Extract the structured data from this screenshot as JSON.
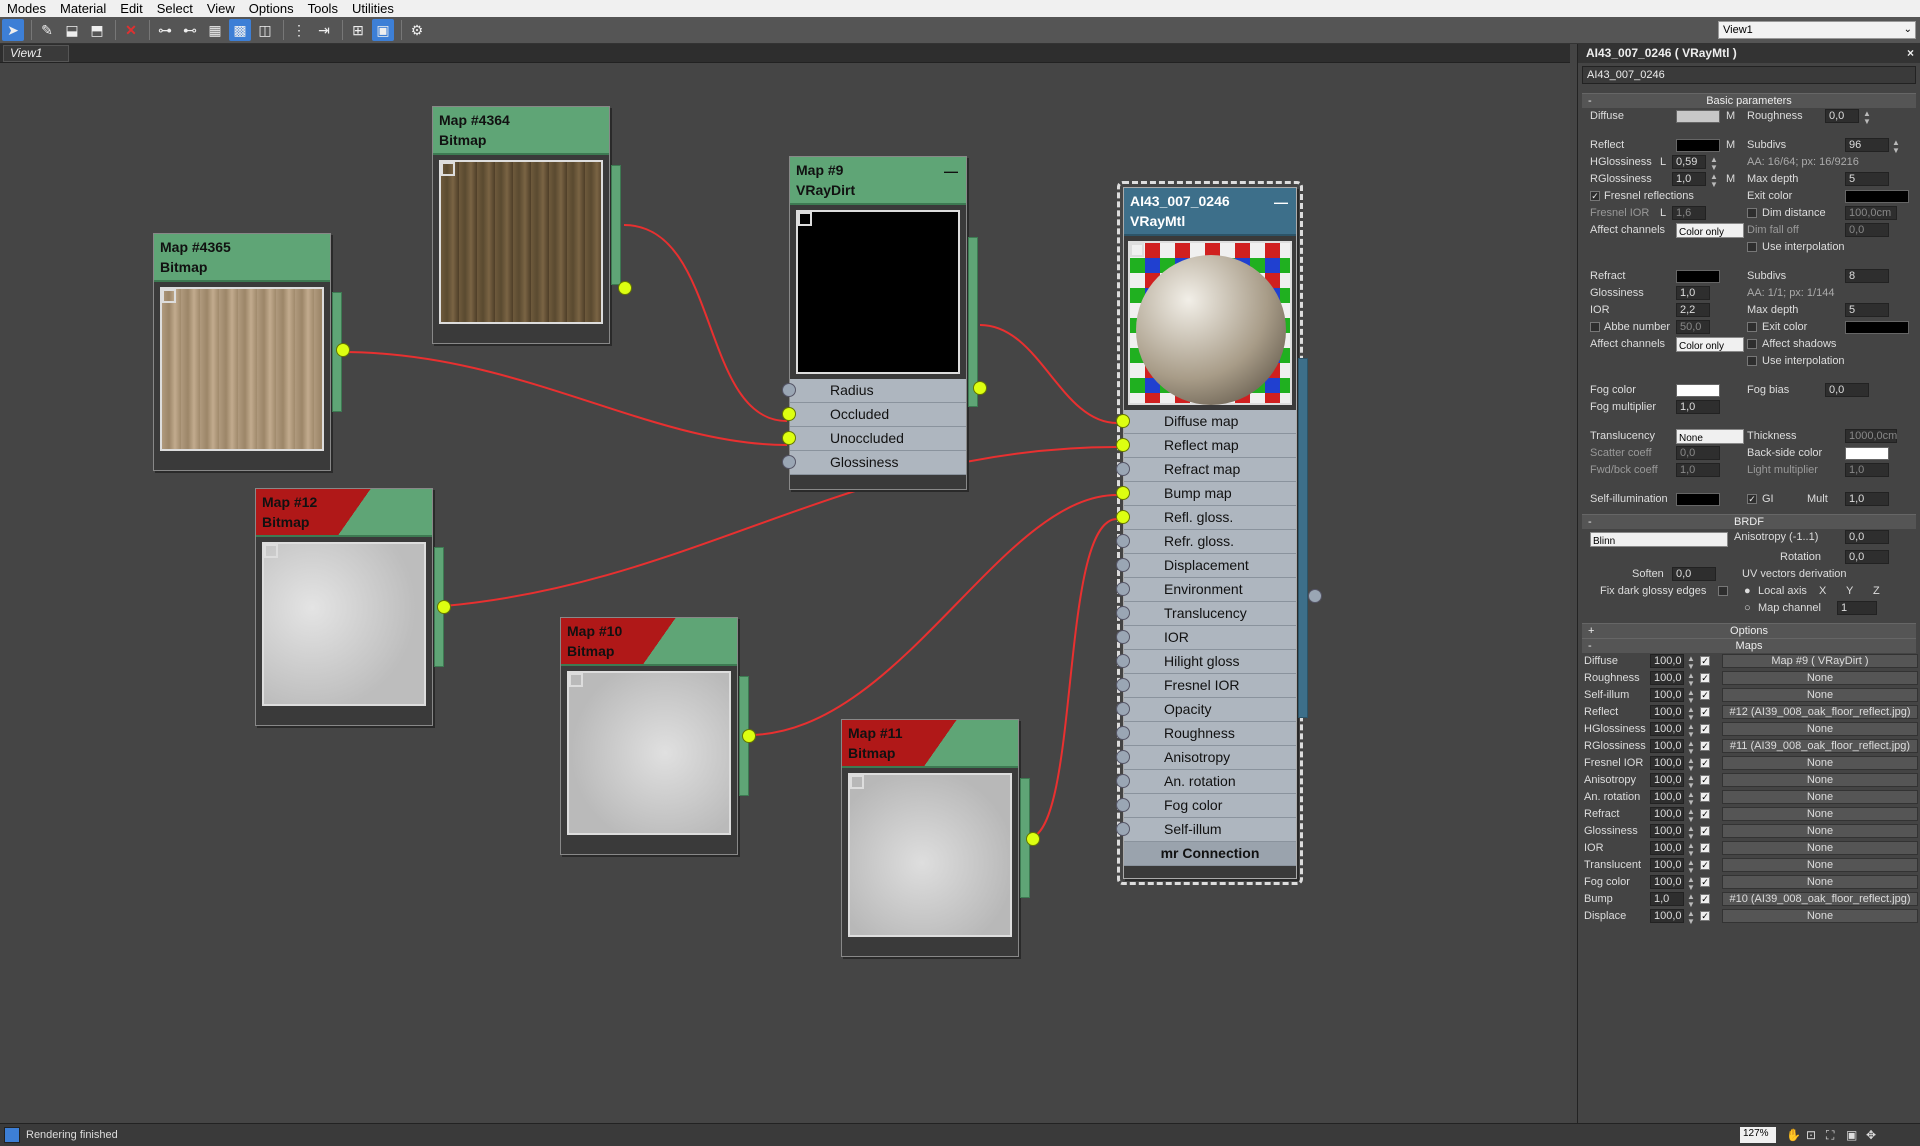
{
  "menu": [
    "Modes",
    "Material",
    "Edit",
    "Select",
    "View",
    "Options",
    "Tools",
    "Utilities"
  ],
  "toolbar_icons": [
    "select-arrow-icon",
    "eyedropper-icon",
    "pick-material-icon",
    "pick-to-icon",
    "delete-icon",
    "layout-all-icon",
    "layout-children-icon",
    "hide-unused-slots-icon",
    "show-background-icon",
    "show-map-icon",
    "move-children-icon",
    "hide-unused-icon",
    "layout-left-icon",
    "show-end-result-icon",
    "select-by-material-icon"
  ],
  "view_dropdown": "View1",
  "view_tab": "View1",
  "nodes": {
    "map4364": {
      "title": "Map #4364",
      "type": "Bitmap"
    },
    "map4365": {
      "title": "Map #4365",
      "type": "Bitmap"
    },
    "map9": {
      "title": "Map #9",
      "type": "VRayDirt",
      "slots": [
        "Radius",
        "Occluded",
        "Unoccluded",
        "Glossiness"
      ]
    },
    "map12": {
      "title": "Map #12",
      "type": "Bitmap"
    },
    "map10": {
      "title": "Map #10",
      "type": "Bitmap"
    },
    "map11": {
      "title": "Map #11",
      "type": "Bitmap"
    },
    "material": {
      "title": "AI43_007_0246",
      "type": "VRayMtl",
      "slots": [
        "Diffuse map",
        "Reflect map",
        "Refract map",
        "Bump map",
        "Refl. gloss.",
        "Refr. gloss.",
        "Displacement",
        "Environment",
        "Translucency",
        "IOR",
        "Hilight gloss",
        "Fresnel IOR",
        "Opacity",
        "Roughness",
        "Anisotropy",
        "An. rotation",
        "Fog color",
        "Self-illum"
      ],
      "bottom": "mr Connection"
    }
  },
  "panel": {
    "title": "AI43_007_0246  ( VRayMtl )",
    "name": "AI43_007_0246",
    "basic_header": "Basic parameters",
    "diffuse": "Diffuse",
    "m": "M",
    "roughness": "Roughness",
    "roughness_val": "0,0",
    "reflect": "Reflect",
    "subdivs": "Subdivs",
    "subdivs_val": "96",
    "hgloss": "HGlossiness",
    "l": "L",
    "hgloss_val": "0,59",
    "aa": "AA: 16/64; px: 16/9216",
    "rgloss": "RGlossiness",
    "rgloss_val": "1,0",
    "maxdepth": "Max depth",
    "maxdepth_val": "5",
    "fresnel": "Fresnel reflections",
    "exitcolor": "Exit color",
    "fresnel_ior": "Fresnel IOR",
    "fresnel_ior_val": "1,6",
    "dimdist": "Dim distance",
    "dimdist_val": "100,0cm",
    "affect": "Affect channels",
    "coloronly": "Color only",
    "dimfall": "Dim fall off",
    "dimfall_val": "0,0",
    "useinterp": "Use interpolation",
    "refract": "Refract",
    "subdivs2_val": "8",
    "glossiness": "Glossiness",
    "gloss_val": "1,0",
    "aa2": "AA: 1/1; px: 1/144",
    "ior": "IOR",
    "ior_val": "2,2",
    "maxdepth2_val": "5",
    "abbe": "Abbe number",
    "abbe_val": "50,0",
    "exitcolor2": "Exit color",
    "affectshadows": "Affect shadows",
    "fogcolor": "Fog color",
    "fogbias": "Fog bias",
    "fogbias_val": "0,0",
    "fogmult": "Fog multiplier",
    "fogmult_val": "1,0",
    "translucency": "Translucency",
    "transl_val": "None",
    "thickness": "Thickness",
    "thickness_val": "1000,0cm",
    "scatter": "Scatter coeff",
    "scatter_val": "0,0",
    "backside": "Back-side color",
    "fwdbck": "Fwd/bck coeff",
    "fwdbck_val": "1,0",
    "lightmult": "Light multiplier",
    "lightmult_val": "1,0",
    "selfillum": "Self-illumination",
    "gi": "GI",
    "mult": "Mult",
    "mult_val": "1,0",
    "brdf_header": "BRDF",
    "brdf_type": "Blinn",
    "aniso": "Anisotropy (-1..1)",
    "aniso_val": "0,0",
    "rotation": "Rotation",
    "rotation_val": "0,0",
    "soften": "Soften",
    "soften_val": "0,0",
    "uvderiv": "UV vectors derivation",
    "fixdark": "Fix dark glossy edges",
    "localaxis": "Local axis",
    "x": "X",
    "y": "Y",
    "z": "Z",
    "mapchannel": "Map channel",
    "mapchannel_val": "1",
    "options_header": "Options",
    "maps_header": "Maps",
    "maps": [
      {
        "name": "Diffuse",
        "val": "100,0",
        "map": "Map #9  ( VRayDirt )"
      },
      {
        "name": "Roughness",
        "val": "100,0",
        "map": "None"
      },
      {
        "name": "Self-illum",
        "val": "100,0",
        "map": "None"
      },
      {
        "name": "Reflect",
        "val": "100,0",
        "map": "#12 (AI39_008_oak_floor_reflect.jpg)"
      },
      {
        "name": "HGlossiness",
        "val": "100,0",
        "map": "None"
      },
      {
        "name": "RGlossiness",
        "val": "100,0",
        "map": "#11 (AI39_008_oak_floor_reflect.jpg)"
      },
      {
        "name": "Fresnel IOR",
        "val": "100,0",
        "map": "None"
      },
      {
        "name": "Anisotropy",
        "val": "100,0",
        "map": "None"
      },
      {
        "name": "An. rotation",
        "val": "100,0",
        "map": "None"
      },
      {
        "name": "Refract",
        "val": "100,0",
        "map": "None"
      },
      {
        "name": "Glossiness",
        "val": "100,0",
        "map": "None"
      },
      {
        "name": "IOR",
        "val": "100,0",
        "map": "None"
      },
      {
        "name": "Translucent",
        "val": "100,0",
        "map": "None"
      },
      {
        "name": "Fog color",
        "val": "100,0",
        "map": "None"
      },
      {
        "name": "Bump",
        "val": "1,0",
        "map": "#10 (AI39_008_oak_floor_reflect.jpg)"
      },
      {
        "name": "Displace",
        "val": "100,0",
        "map": "None"
      }
    ]
  },
  "status": {
    "text": "Rendering finished",
    "zoom": "127%"
  },
  "colors": {
    "node_green": "#5fa576",
    "node_red": "#b01818",
    "wire": "#e83030",
    "socket": "#ddff11",
    "panel_bg": "#444444"
  }
}
